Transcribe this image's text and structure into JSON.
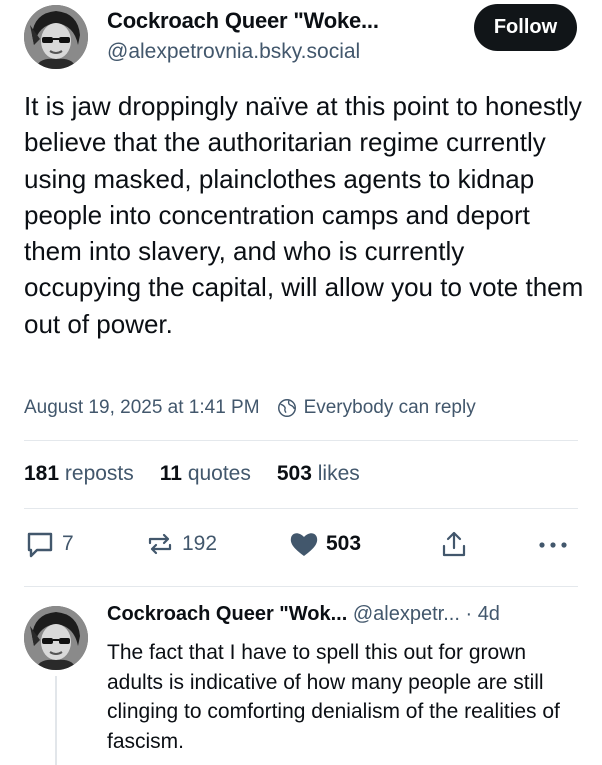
{
  "author": {
    "display_name": "Cockroach Queer \"Woke...",
    "handle": "@alexpetrovnia.bsky.social",
    "follow_label": "Follow"
  },
  "post": {
    "text": "It is jaw droppingly naïve at this point to honestly believe that the authoritarian regime currently using masked, plainclothes agents to kidnap people into concentration camps and deport them into slavery, and who is currently occupying the capital, will allow you to vote them out of power.",
    "timestamp": "August 19, 2025 at 1:41 PM",
    "reply_setting": "Everybody can reply"
  },
  "stats": {
    "reposts_count": "181",
    "reposts_label": "reposts",
    "quotes_count": "11",
    "quotes_label": "quotes",
    "likes_count": "503",
    "likes_label": "likes"
  },
  "actions": {
    "reply_count": "7",
    "repost_count": "192",
    "like_count": "503",
    "icons": [
      "reply-icon",
      "repost-icon",
      "heart-icon",
      "share-icon",
      "more-icon"
    ]
  },
  "reply": {
    "display_name": "Cockroach Queer \"Wok...",
    "handle": "@alexpetr...",
    "separator": "·",
    "age": "4d",
    "text": "The fact that I have to spell this out for grown adults is indicative of how many people are still clinging to comforting denialism of the realities of fascism."
  },
  "colors": {
    "text": "#0b0f14",
    "secondary": "#42576c",
    "follow_bg": "#111518",
    "divider": "#e4e8ec"
  }
}
